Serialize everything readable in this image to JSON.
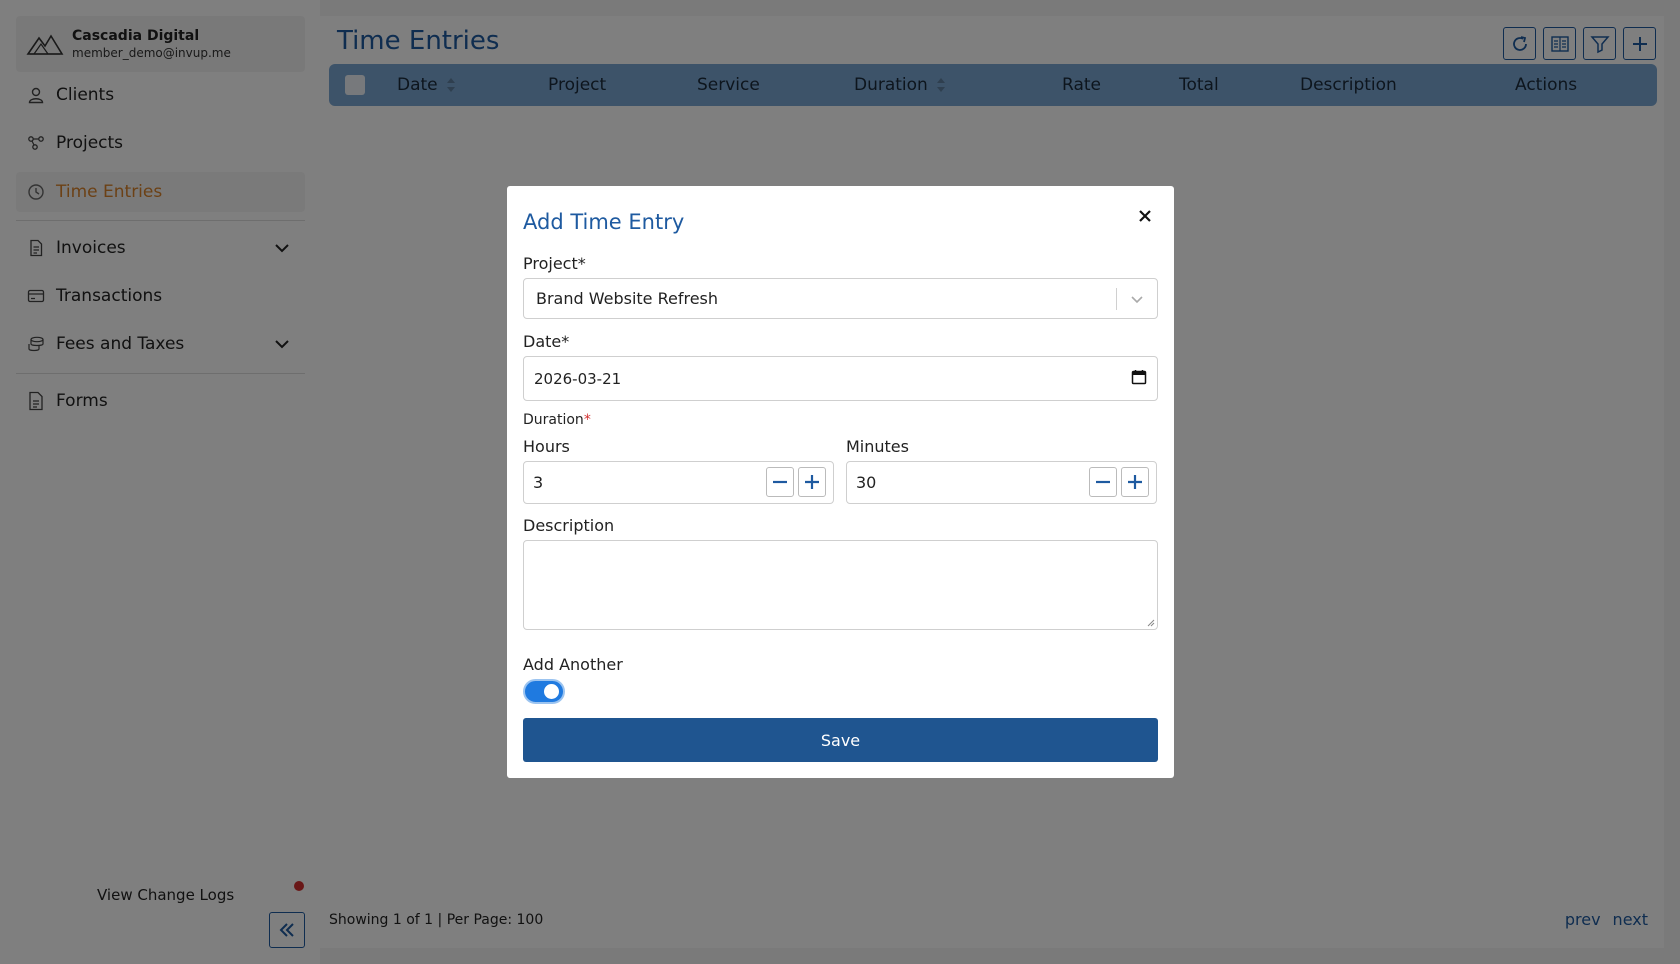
{
  "org": {
    "name": "Cascadia Digital",
    "email": "member_demo@invup.me"
  },
  "sidebar": {
    "items": [
      {
        "label": "Clients"
      },
      {
        "label": "Projects"
      },
      {
        "label": "Time Entries"
      },
      {
        "label": "Invoices"
      },
      {
        "label": "Transactions"
      },
      {
        "label": "Fees and Taxes"
      },
      {
        "label": "Forms"
      }
    ],
    "changelog": "View Change Logs"
  },
  "page": {
    "title": "Time Entries"
  },
  "table": {
    "columns": [
      "Date",
      "Project",
      "Service",
      "Duration",
      "Rate",
      "Total",
      "Description",
      "Actions"
    ]
  },
  "footer": {
    "info": "Showing 1 of 1 | Per Page: 100",
    "prev": "prev",
    "next": "next"
  },
  "modal": {
    "title": "Add Time Entry",
    "close_icon": "×",
    "project_label": "Project*",
    "project_value": "Brand Website Refresh",
    "date_label": "Date*",
    "date_value": "2026-03-21",
    "duration_label": "Duration",
    "duration_required": "*",
    "hours_label": "Hours",
    "hours_value": "3",
    "minutes_label": "Minutes",
    "minutes_value": "30",
    "description_label": "Description",
    "add_another_label": "Add Another",
    "add_another_on": true,
    "save_label": "Save"
  },
  "colors": {
    "brand": "#1e5aa0",
    "active_nav": "#d9822b",
    "table_header": "#7aa6d3",
    "save_button": "#1f5590",
    "toggle_on": "#1f7ae0"
  }
}
